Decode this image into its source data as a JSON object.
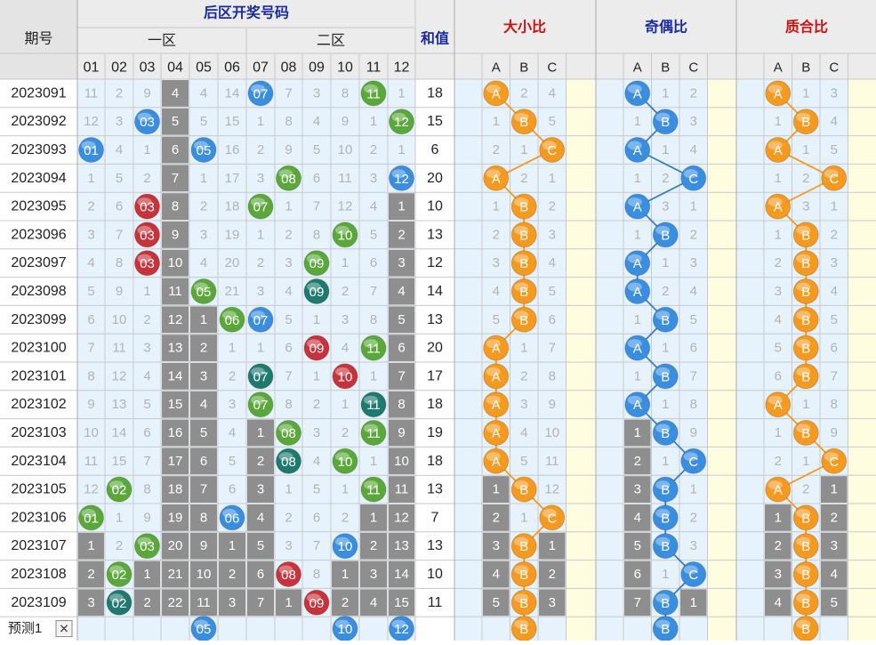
{
  "header": {
    "issue": "期号",
    "back_title": "后区开奖号码",
    "zone1": "一区",
    "zone2": "二区",
    "sum": "和值",
    "size_ratio": "大小比",
    "odd_even_ratio": "奇偶比",
    "prime_ratio": "质合比",
    "columns": [
      "01",
      "02",
      "03",
      "04",
      "05",
      "06",
      "07",
      "08",
      "09",
      "10",
      "11",
      "12"
    ],
    "abc": [
      "A",
      "B",
      "C"
    ]
  },
  "colors": {
    "blue_ball": "#3a8ee0",
    "green_ball": "#5aa83a",
    "red_ball": "#c8323a",
    "teal_ball": "#1e7a6e",
    "orange_ball": "#f59a1e",
    "gray_cell": "#8e8e8e",
    "header_title_blue": "#1a2aa0",
    "header_title_red": "#d01010",
    "cream": "#fffde0",
    "pale_blue": "#e6f3fc"
  },
  "chart_data": {
    "type": "table",
    "rows": [
      {
        "issue": "2023091",
        "cells": [
          "11",
          "2",
          "9",
          "4",
          "4",
          "14",
          "07",
          "7",
          "3",
          "8",
          "11",
          "1"
        ],
        "sum": "18",
        "size": [
          "A",
          "2",
          "4"
        ],
        "oe": [
          "A",
          "1",
          "2"
        ],
        "pc": [
          "A",
          "1",
          "3"
        ]
      },
      {
        "issue": "2023092",
        "cells": [
          "12",
          "3",
          "03",
          "5",
          "5",
          "15",
          "1",
          "8",
          "4",
          "9",
          "1",
          "12"
        ],
        "sum": "15",
        "size": [
          "1",
          "B",
          "5"
        ],
        "oe": [
          "1",
          "B",
          "3"
        ],
        "pc": [
          "1",
          "B",
          "4"
        ]
      },
      {
        "issue": "2023093",
        "cells": [
          "01",
          "4",
          "1",
          "6",
          "05",
          "16",
          "2",
          "9",
          "5",
          "10",
          "2",
          "1"
        ],
        "sum": "6",
        "size": [
          "2",
          "1",
          "C"
        ],
        "oe": [
          "A",
          "1",
          "4"
        ],
        "pc": [
          "A",
          "1",
          "5"
        ]
      },
      {
        "issue": "2023094",
        "cells": [
          "1",
          "5",
          "2",
          "7",
          "1",
          "17",
          "3",
          "08",
          "6",
          "11",
          "3",
          "12"
        ],
        "sum": "20",
        "size": [
          "A",
          "2",
          "1"
        ],
        "oe": [
          "1",
          "2",
          "C"
        ],
        "pc": [
          "1",
          "2",
          "C"
        ]
      },
      {
        "issue": "2023095",
        "cells": [
          "2",
          "6",
          "03",
          "8",
          "2",
          "18",
          "07",
          "1",
          "7",
          "12",
          "4",
          "1"
        ],
        "sum": "10",
        "size": [
          "1",
          "B",
          "2"
        ],
        "oe": [
          "A",
          "3",
          "1"
        ],
        "pc": [
          "A",
          "3",
          "1"
        ]
      },
      {
        "issue": "2023096",
        "cells": [
          "3",
          "7",
          "03",
          "9",
          "3",
          "19",
          "1",
          "2",
          "8",
          "10",
          "5",
          "2"
        ],
        "sum": "13",
        "size": [
          "2",
          "B",
          "3"
        ],
        "oe": [
          "1",
          "B",
          "2"
        ],
        "pc": [
          "1",
          "B",
          "2"
        ]
      },
      {
        "issue": "2023097",
        "cells": [
          "4",
          "8",
          "03",
          "10",
          "4",
          "20",
          "2",
          "3",
          "09",
          "1",
          "6",
          "3"
        ],
        "sum": "12",
        "size": [
          "3",
          "B",
          "4"
        ],
        "oe": [
          "A",
          "1",
          "3"
        ],
        "pc": [
          "2",
          "B",
          "3"
        ]
      },
      {
        "issue": "2023098",
        "cells": [
          "5",
          "9",
          "1",
          "11",
          "05",
          "21",
          "3",
          "4",
          "09",
          "2",
          "7",
          "4"
        ],
        "sum": "14",
        "size": [
          "4",
          "B",
          "5"
        ],
        "oe": [
          "A",
          "2",
          "4"
        ],
        "pc": [
          "3",
          "B",
          "4"
        ]
      },
      {
        "issue": "2023099",
        "cells": [
          "6",
          "10",
          "2",
          "12",
          "1",
          "06",
          "07",
          "5",
          "1",
          "3",
          "8",
          "5"
        ],
        "sum": "13",
        "size": [
          "5",
          "B",
          "6"
        ],
        "oe": [
          "1",
          "B",
          "5"
        ],
        "pc": [
          "4",
          "B",
          "5"
        ]
      },
      {
        "issue": "2023100",
        "cells": [
          "7",
          "11",
          "3",
          "13",
          "2",
          "1",
          "1",
          "6",
          "09",
          "4",
          "11",
          "6"
        ],
        "sum": "20",
        "size": [
          "A",
          "1",
          "7"
        ],
        "oe": [
          "A",
          "1",
          "6"
        ],
        "pc": [
          "5",
          "B",
          "6"
        ]
      },
      {
        "issue": "2023101",
        "cells": [
          "8",
          "12",
          "4",
          "14",
          "3",
          "2",
          "07",
          "7",
          "1",
          "10",
          "1",
          "7"
        ],
        "sum": "17",
        "size": [
          "A",
          "2",
          "8"
        ],
        "oe": [
          "1",
          "B",
          "7"
        ],
        "pc": [
          "6",
          "B",
          "7"
        ]
      },
      {
        "issue": "2023102",
        "cells": [
          "9",
          "13",
          "5",
          "15",
          "4",
          "3",
          "07",
          "8",
          "2",
          "1",
          "11",
          "8"
        ],
        "sum": "18",
        "size": [
          "A",
          "3",
          "9"
        ],
        "oe": [
          "A",
          "1",
          "8"
        ],
        "pc": [
          "A",
          "1",
          "8"
        ]
      },
      {
        "issue": "2023103",
        "cells": [
          "10",
          "14",
          "6",
          "16",
          "5",
          "4",
          "1",
          "08",
          "3",
          "2",
          "11",
          "9"
        ],
        "sum": "19",
        "size": [
          "A",
          "4",
          "10"
        ],
        "oe": [
          "1",
          "B",
          "9"
        ],
        "pc": [
          "1",
          "B",
          "9"
        ]
      },
      {
        "issue": "2023104",
        "cells": [
          "11",
          "15",
          "7",
          "17",
          "6",
          "5",
          "2",
          "08",
          "4",
          "10",
          "1",
          "10"
        ],
        "sum": "18",
        "size": [
          "A",
          "5",
          "11"
        ],
        "oe": [
          "2",
          "1",
          "C"
        ],
        "pc": [
          "2",
          "1",
          "C"
        ]
      },
      {
        "issue": "2023105",
        "cells": [
          "12",
          "02",
          "8",
          "18",
          "7",
          "6",
          "3",
          "1",
          "5",
          "1",
          "11",
          "11"
        ],
        "sum": "13",
        "size": [
          "1",
          "B",
          "12"
        ],
        "oe": [
          "3",
          "B",
          "1"
        ],
        "pc": [
          "A",
          "2",
          "1"
        ]
      },
      {
        "issue": "2023106",
        "cells": [
          "01",
          "1",
          "9",
          "19",
          "8",
          "06",
          "4",
          "2",
          "6",
          "2",
          "1",
          "12"
        ],
        "sum": "7",
        "size": [
          "2",
          "1",
          "C"
        ],
        "oe": [
          "4",
          "B",
          "2"
        ],
        "pc": [
          "1",
          "B",
          "2"
        ]
      },
      {
        "issue": "2023107",
        "cells": [
          "1",
          "2",
          "03",
          "20",
          "9",
          "1",
          "5",
          "3",
          "7",
          "10",
          "2",
          "13"
        ],
        "sum": "13",
        "size": [
          "3",
          "B",
          "1"
        ],
        "oe": [
          "5",
          "B",
          "3"
        ],
        "pc": [
          "2",
          "B",
          "3"
        ]
      },
      {
        "issue": "2023108",
        "cells": [
          "2",
          "02",
          "1",
          "21",
          "10",
          "2",
          "6",
          "08",
          "8",
          "1",
          "3",
          "14"
        ],
        "sum": "10",
        "size": [
          "4",
          "B",
          "2"
        ],
        "oe": [
          "6",
          "1",
          "C"
        ],
        "pc": [
          "3",
          "B",
          "4"
        ]
      },
      {
        "issue": "2023109",
        "cells": [
          "3",
          "02",
          "2",
          "22",
          "11",
          "3",
          "7",
          "1",
          "09",
          "2",
          "4",
          "15"
        ],
        "sum": "11",
        "size": [
          "5",
          "B",
          "3"
        ],
        "oe": [
          "7",
          "B",
          "1"
        ],
        "pc": [
          "4",
          "B",
          "5"
        ]
      }
    ],
    "cell_styles": [
      [
        "m",
        "m",
        "m",
        "g",
        "m",
        "m",
        "b",
        "m",
        "m",
        "m",
        "gb",
        "m"
      ],
      [
        "m",
        "m",
        "b",
        "g",
        "m",
        "m",
        "m",
        "m",
        "m",
        "m",
        "m",
        "gb"
      ],
      [
        "b",
        "m",
        "m",
        "g",
        "b",
        "m",
        "m",
        "m",
        "m",
        "m",
        "m",
        "m"
      ],
      [
        "m",
        "m",
        "m",
        "g",
        "m",
        "m",
        "m",
        "gb",
        "m",
        "m",
        "m",
        "b"
      ],
      [
        "m",
        "m",
        "rb",
        "g",
        "m",
        "m",
        "gb",
        "m",
        "m",
        "m",
        "m",
        "g"
      ],
      [
        "m",
        "m",
        "rb",
        "g",
        "m",
        "m",
        "m",
        "m",
        "m",
        "gb",
        "m",
        "g"
      ],
      [
        "m",
        "m",
        "rb",
        "g",
        "m",
        "m",
        "m",
        "m",
        "gb",
        "m",
        "m",
        "g"
      ],
      [
        "m",
        "m",
        "m",
        "g",
        "gb",
        "m",
        "m",
        "m",
        "tb",
        "m",
        "m",
        "g"
      ],
      [
        "m",
        "m",
        "m",
        "g",
        "g",
        "gb",
        "b",
        "m",
        "m",
        "m",
        "m",
        "g"
      ],
      [
        "m",
        "m",
        "m",
        "g",
        "g",
        "m",
        "m",
        "m",
        "rb",
        "m",
        "gb",
        "g"
      ],
      [
        "m",
        "m",
        "m",
        "g",
        "g",
        "m",
        "tb",
        "m",
        "m",
        "rb",
        "m",
        "g"
      ],
      [
        "m",
        "m",
        "m",
        "g",
        "g",
        "m",
        "gb",
        "m",
        "m",
        "m",
        "tb",
        "g"
      ],
      [
        "m",
        "m",
        "m",
        "g",
        "g",
        "m",
        "g",
        "gb",
        "m",
        "m",
        "gb",
        "g"
      ],
      [
        "m",
        "m",
        "m",
        "g",
        "g",
        "m",
        "g",
        "tb",
        "m",
        "gb",
        "m",
        "g"
      ],
      [
        "m",
        "gb",
        "m",
        "g",
        "g",
        "m",
        "g",
        "m",
        "m",
        "m",
        "gb",
        "g"
      ],
      [
        "gb",
        "m",
        "m",
        "g",
        "g",
        "b",
        "g",
        "m",
        "m",
        "m",
        "g",
        "g"
      ],
      [
        "g",
        "m",
        "gb",
        "g",
        "g",
        "g",
        "g",
        "m",
        "m",
        "b",
        "g",
        "g"
      ],
      [
        "g",
        "gb",
        "g",
        "g",
        "g",
        "g",
        "g",
        "rb",
        "m",
        "g",
        "g",
        "g"
      ],
      [
        "g",
        "tb",
        "g",
        "g",
        "g",
        "g",
        "g",
        "g",
        "rb",
        "g",
        "g",
        "g"
      ]
    ],
    "ratio_styles": {
      "size": [
        [
          "o",
          "m",
          "m"
        ],
        [
          "m",
          "o",
          "m"
        ],
        [
          "m",
          "m",
          "o"
        ],
        [
          "o",
          "m",
          "m"
        ],
        [
          "m",
          "o",
          "m"
        ],
        [
          "m",
          "o",
          "m"
        ],
        [
          "m",
          "o",
          "m"
        ],
        [
          "m",
          "o",
          "m"
        ],
        [
          "m",
          "o",
          "m"
        ],
        [
          "o",
          "m",
          "m"
        ],
        [
          "o",
          "m",
          "m"
        ],
        [
          "o",
          "m",
          "m"
        ],
        [
          "o",
          "m",
          "m"
        ],
        [
          "o",
          "m",
          "m"
        ],
        [
          "g",
          "o",
          "m"
        ],
        [
          "g",
          "m",
          "o"
        ],
        [
          "g",
          "o",
          "g"
        ],
        [
          "g",
          "o",
          "g"
        ],
        [
          "g",
          "o",
          "g"
        ]
      ],
      "oe": [
        [
          "b",
          "m",
          "m"
        ],
        [
          "m",
          "b",
          "m"
        ],
        [
          "b",
          "m",
          "m"
        ],
        [
          "m",
          "m",
          "b"
        ],
        [
          "b",
          "m",
          "m"
        ],
        [
          "m",
          "b",
          "m"
        ],
        [
          "b",
          "m",
          "m"
        ],
        [
          "b",
          "m",
          "m"
        ],
        [
          "m",
          "b",
          "m"
        ],
        [
          "b",
          "m",
          "m"
        ],
        [
          "m",
          "b",
          "m"
        ],
        [
          "b",
          "m",
          "m"
        ],
        [
          "g",
          "b",
          "m"
        ],
        [
          "g",
          "m",
          "b"
        ],
        [
          "g",
          "b",
          "m"
        ],
        [
          "g",
          "b",
          "m"
        ],
        [
          "g",
          "b",
          "m"
        ],
        [
          "g",
          "m",
          "b"
        ],
        [
          "g",
          "b",
          "g"
        ]
      ],
      "pc": [
        [
          "o",
          "m",
          "m"
        ],
        [
          "m",
          "o",
          "m"
        ],
        [
          "o",
          "m",
          "m"
        ],
        [
          "m",
          "m",
          "o"
        ],
        [
          "o",
          "m",
          "m"
        ],
        [
          "m",
          "o",
          "m"
        ],
        [
          "m",
          "o",
          "m"
        ],
        [
          "m",
          "o",
          "m"
        ],
        [
          "m",
          "o",
          "m"
        ],
        [
          "m",
          "o",
          "m"
        ],
        [
          "m",
          "o",
          "m"
        ],
        [
          "o",
          "m",
          "m"
        ],
        [
          "m",
          "o",
          "m"
        ],
        [
          "m",
          "m",
          "o"
        ],
        [
          "o",
          "m",
          "g"
        ],
        [
          "g",
          "o",
          "g"
        ],
        [
          "g",
          "o",
          "g"
        ],
        [
          "g",
          "o",
          "g"
        ],
        [
          "g",
          "o",
          "g"
        ]
      ]
    },
    "prediction": {
      "label": "预测1",
      "close": "✕",
      "balls": [
        {
          "col": 4,
          "text": "05"
        },
        {
          "col": 9,
          "text": "10"
        },
        {
          "col": 11,
          "text": "12"
        }
      ],
      "size_ball": "B",
      "oe_ball": "B",
      "pc_ball": "B"
    }
  }
}
